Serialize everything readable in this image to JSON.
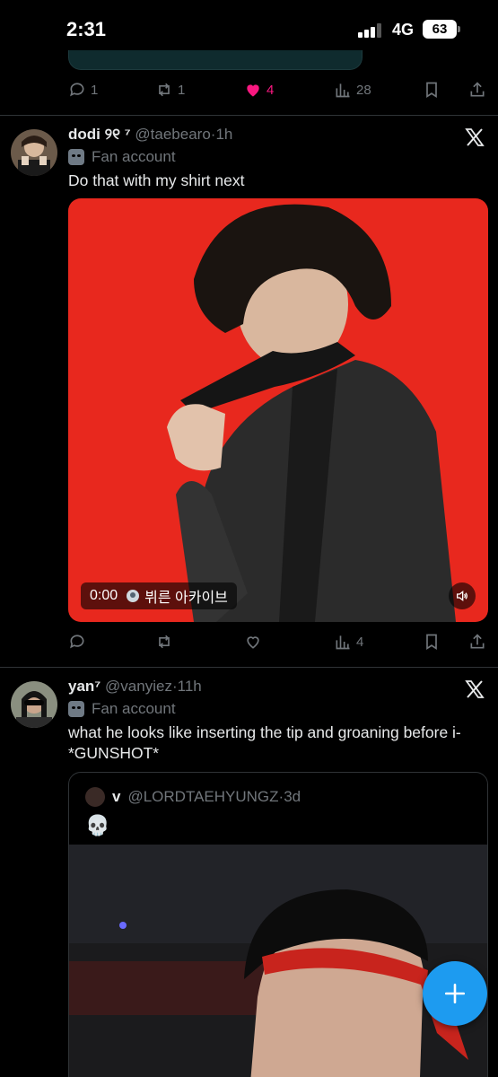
{
  "status_bar": {
    "time": "2:31",
    "network": "4G",
    "battery": "63"
  },
  "prev_tweet": {
    "actions": {
      "replies": "1",
      "reposts": "1",
      "likes": "4",
      "views": "28"
    }
  },
  "tweet1": {
    "author": "dodi ୨୧ ⁷",
    "handle": "@taebearo",
    "time": "1h",
    "label": "Fan account",
    "text": "Do that with my shirt next",
    "video": {
      "time": "0:00",
      "source": "뷔른 아카이브"
    },
    "actions": {
      "views": "4"
    }
  },
  "tweet2": {
    "author": "yan⁷",
    "handle": "@vanyiez",
    "time": "11h",
    "label": "Fan account",
    "text": "what he looks like inserting the tip and groaning before i- *GUNSHOT*",
    "quote": {
      "author": "v",
      "handle": "@LORDTAEHYUNGZ",
      "time": "3d",
      "text": "💀"
    }
  },
  "colors": {
    "accent": "#1d9bf0",
    "like": "#f91880",
    "muted": "#71767b"
  }
}
